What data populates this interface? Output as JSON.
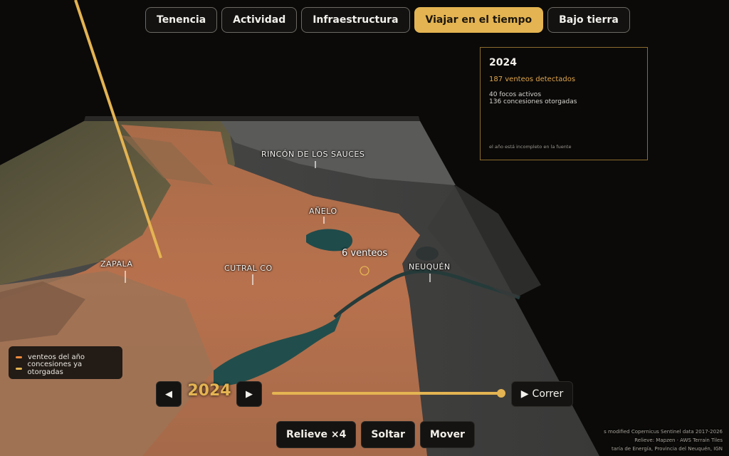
{
  "tabs": [
    {
      "label": "Tenencia",
      "active": false
    },
    {
      "label": "Actividad",
      "active": false
    },
    {
      "label": "Infraestructura",
      "active": false
    },
    {
      "label": "Viajar en el tiempo",
      "active": true
    },
    {
      "label": "Bajo tierra",
      "active": false
    }
  ],
  "info_panel": {
    "year": "2024",
    "detected": "187 venteos detectados",
    "active_foci": "40 focos activos",
    "concessions": "136 concesiones otorgadas",
    "note": "el año está incompleto en la fuente"
  },
  "map": {
    "places": {
      "rincon": "RINCÓN DE LOS SAUCES",
      "anelo": "AÑELO",
      "zapala": "ZAPALA",
      "cutral_co": "CUTRAL CO",
      "neuquen": "NEUQUÉN"
    },
    "count_label": "6 venteos"
  },
  "legend": {
    "items": [
      {
        "label": "venteos del año",
        "color": "#f08a3c"
      },
      {
        "label": "concesiones ya otorgadas",
        "color": "#e4b452"
      }
    ]
  },
  "timeline": {
    "year": "2024",
    "prev_icon": "◀",
    "next_icon": "▶",
    "progress": 1.0,
    "run_icon": "▶",
    "run_label": "Correr"
  },
  "controls": {
    "relief_label": "Relieve ×4",
    "release_label": "Soltar",
    "move_label": "Mover"
  },
  "credits": {
    "line1": "s modified Copernicus Sentinel data 2017-2026",
    "line2": "Relieve: Mapzen · AWS Terrain Tiles",
    "line3": "taría de Energía, Provincia del Neuquén, IGN"
  },
  "colors": {
    "accent": "#e4b452",
    "background": "#0b0a09"
  }
}
